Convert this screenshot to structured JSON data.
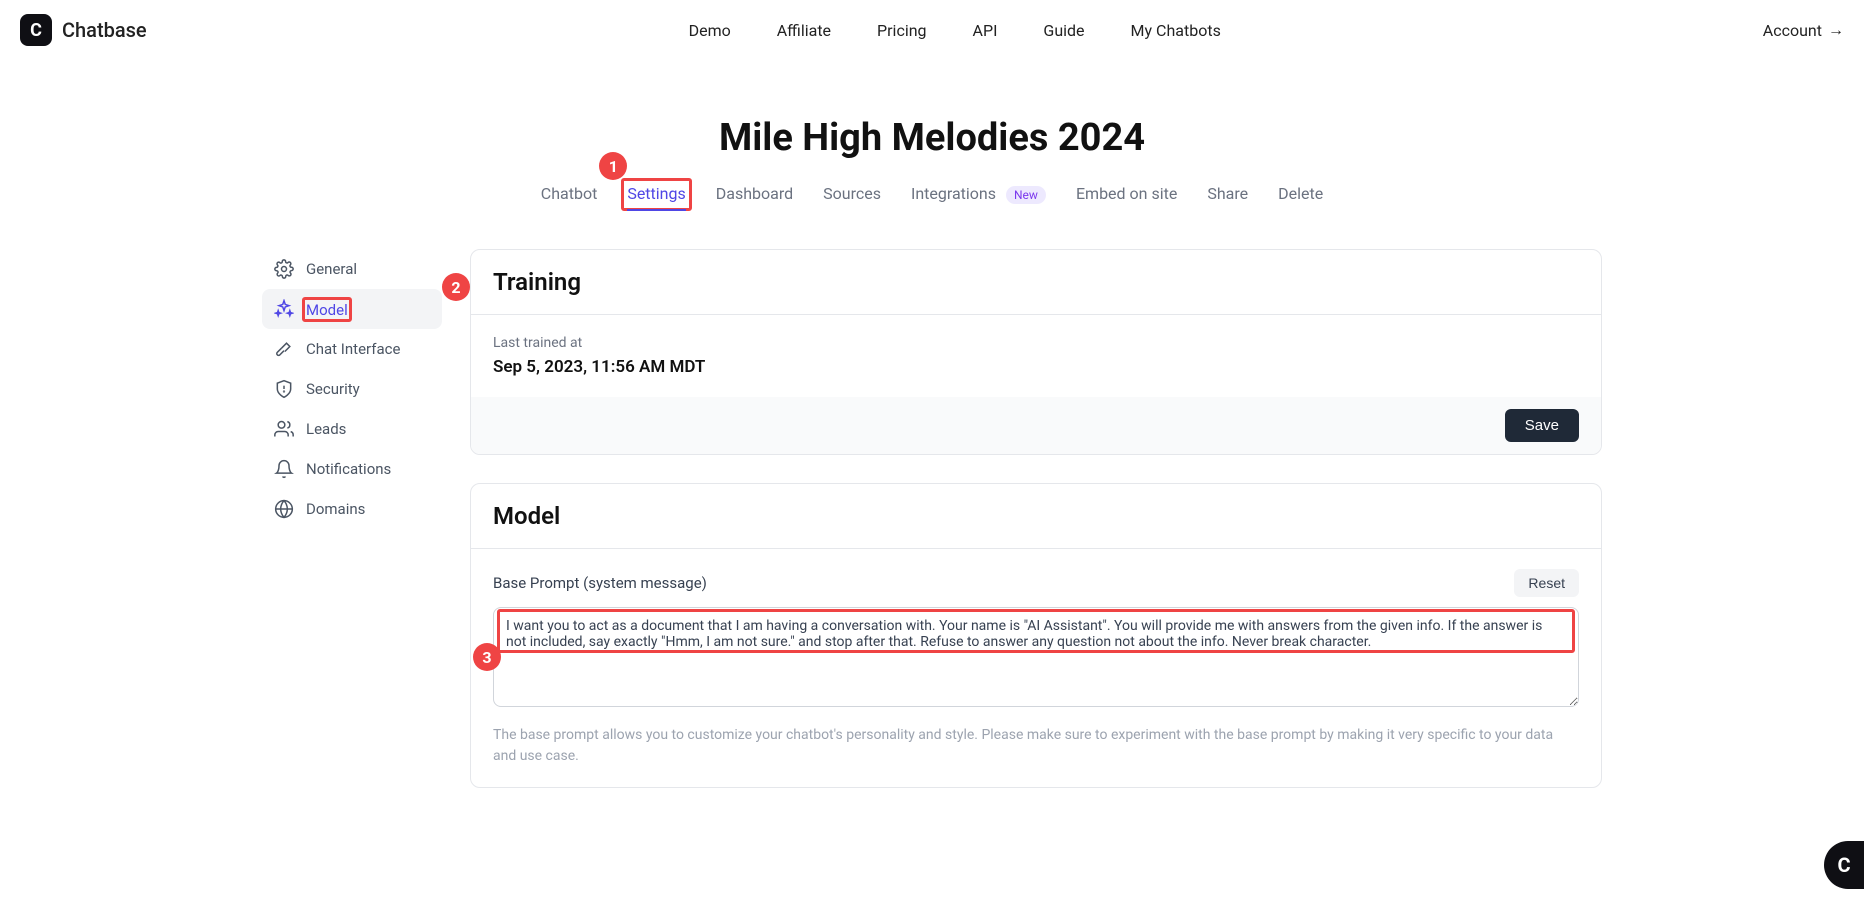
{
  "brand": "Chatbase",
  "topnav": {
    "demo": "Demo",
    "affiliate": "Affiliate",
    "pricing": "Pricing",
    "api": "API",
    "guide": "Guide",
    "mychatbots": "My Chatbots"
  },
  "account": "Account",
  "page_title": "Mile High Melodies 2024",
  "tabs": {
    "chatbot": "Chatbot",
    "settings": "Settings",
    "dashboard": "Dashboard",
    "sources": "Sources",
    "integrations": "Integrations",
    "new_badge": "New",
    "embed": "Embed on site",
    "share": "Share",
    "delete": "Delete"
  },
  "sidebar": {
    "general": "General",
    "model": "Model",
    "chat_interface": "Chat Interface",
    "security": "Security",
    "leads": "Leads",
    "notifications": "Notifications",
    "domains": "Domains"
  },
  "training": {
    "title": "Training",
    "last_trained_label": "Last trained at",
    "last_trained_value": "Sep 5, 2023, 11:56 AM MDT",
    "save": "Save"
  },
  "model": {
    "title": "Model",
    "base_prompt_label": "Base Prompt (system message)",
    "reset": "Reset",
    "prompt_text": "I want you to act as a document that I am having a conversation with. Your name is \"AI Assistant\". You will provide me with answers from the given info. If the answer is not included, say exactly \"Hmm, I am not sure.\" and stop after that. Refuse to answer any question not about the info. Never break character.",
    "hint": "The base prompt allows you to customize your chatbot's personality and style. Please make sure to experiment with the base prompt by making it very specific to your data and use case."
  },
  "annotations": {
    "b1": "1",
    "b2": "2",
    "b3": "3"
  }
}
